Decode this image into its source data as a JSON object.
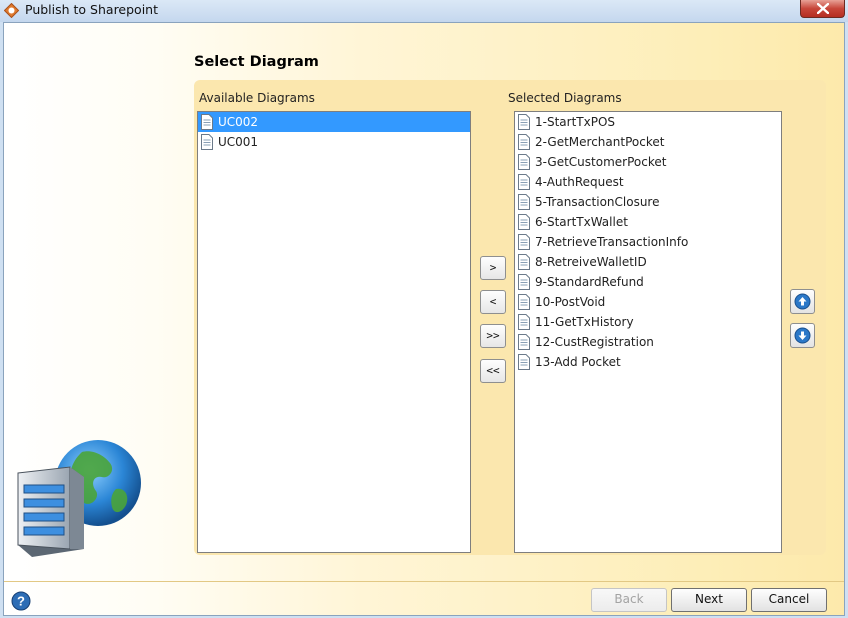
{
  "window": {
    "title": "Publish to Sharepoint",
    "app_icon": "app-logo-icon",
    "close_icon": "close-icon"
  },
  "page": {
    "heading": "Select Diagram"
  },
  "available": {
    "label": "Available Diagrams",
    "items": [
      {
        "label": "UC002",
        "selected": true
      },
      {
        "label": "UC001",
        "selected": false
      }
    ]
  },
  "selected": {
    "label": "Selected Diagrams",
    "items": [
      {
        "label": "1-StartTxPOS"
      },
      {
        "label": "2-GetMerchantPocket"
      },
      {
        "label": "3-GetCustomerPocket"
      },
      {
        "label": "4-AuthRequest"
      },
      {
        "label": "5-TransactionClosure"
      },
      {
        "label": "6-StartTxWallet"
      },
      {
        "label": "7-RetrieveTransactionInfo"
      },
      {
        "label": "8-RetreiveWalletID"
      },
      {
        "label": "9-StandardRefund"
      },
      {
        "label": "10-PostVoid"
      },
      {
        "label": "11-GetTxHistory"
      },
      {
        "label": "12-CustRegistration"
      },
      {
        "label": "13-Add Pocket"
      }
    ]
  },
  "transfer": {
    "add_label": ">",
    "remove_label": "<",
    "add_all_label": ">>",
    "remove_all_label": "<<"
  },
  "order": {
    "up_icon": "arrow-up-icon",
    "down_icon": "arrow-down-icon"
  },
  "footer": {
    "help_icon": "help-icon",
    "back_label": "Back",
    "next_label": "Next",
    "cancel_label": "Cancel"
  },
  "colors": {
    "selection": "#3399ff",
    "panel": "#fbe7ae",
    "close": "#c7463a"
  }
}
